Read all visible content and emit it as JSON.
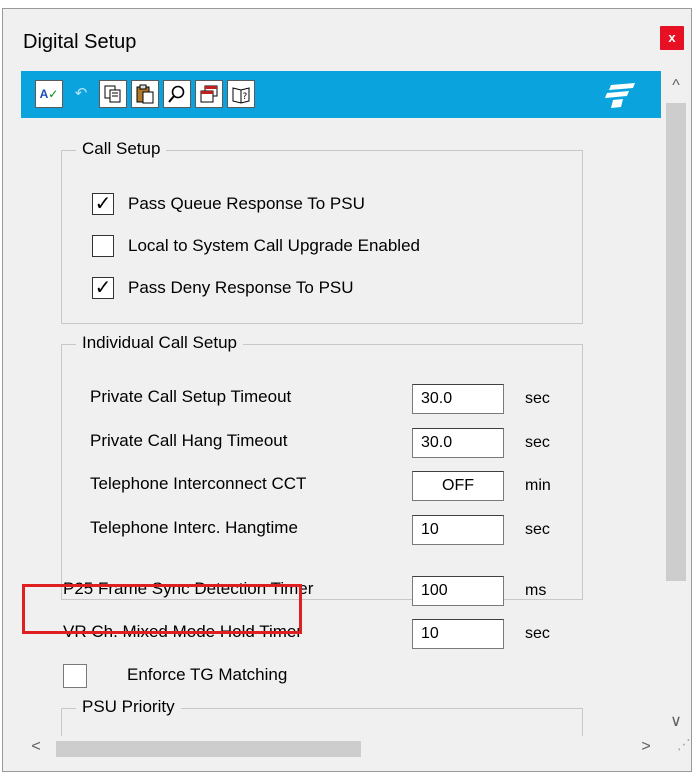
{
  "window": {
    "title": "Digital Setup",
    "close_label": "x"
  },
  "toolbar": {
    "buttons": [
      {
        "name": "spellcheck",
        "glyph": "A✓"
      },
      {
        "name": "undo",
        "glyph": "↶"
      },
      {
        "name": "copy",
        "glyph": "❐"
      },
      {
        "name": "paste",
        "glyph": "⎘"
      },
      {
        "name": "find",
        "glyph": "⌕"
      },
      {
        "name": "window",
        "glyph": "❐"
      },
      {
        "name": "help",
        "glyph": "?"
      }
    ]
  },
  "call_setup": {
    "title": "Call Setup",
    "items": [
      {
        "label": "Pass Queue Response To PSU",
        "checked": true
      },
      {
        "label": "Local to System Call Upgrade Enabled",
        "checked": false
      },
      {
        "label": "Pass Deny Response To PSU",
        "checked": true
      }
    ]
  },
  "individual_call_setup": {
    "title": "Individual Call Setup",
    "rows": [
      {
        "label": "Private Call Setup Timeout",
        "value": "30.0",
        "unit": "sec"
      },
      {
        "label": "Private Call Hang Timeout",
        "value": "30.0",
        "unit": "sec"
      },
      {
        "label": "Telephone Interconnect CCT",
        "value": "OFF",
        "unit": "min"
      },
      {
        "label": "Telephone Interc. Hangtime",
        "value": "10",
        "unit": "sec"
      }
    ]
  },
  "timers": [
    {
      "label": "P25 Frame Sync Detection Timer",
      "value": "100",
      "unit": "ms"
    },
    {
      "label": "VR Ch. Mixed Mode Hold Timer",
      "value": "10",
      "unit": "sec"
    }
  ],
  "enforce_tg": {
    "label": "Enforce TG Matching",
    "checked": false
  },
  "psu_priority": {
    "title": "PSU Priority"
  },
  "scroll": {
    "up": "^",
    "down": "∨",
    "left": "<",
    "right": ">",
    "grip": "⋰"
  },
  "marks": {
    "check": "✓"
  },
  "colors": {
    "toolbar": "#0aa3dd",
    "highlight": "#e02020",
    "close": "#e81123"
  }
}
